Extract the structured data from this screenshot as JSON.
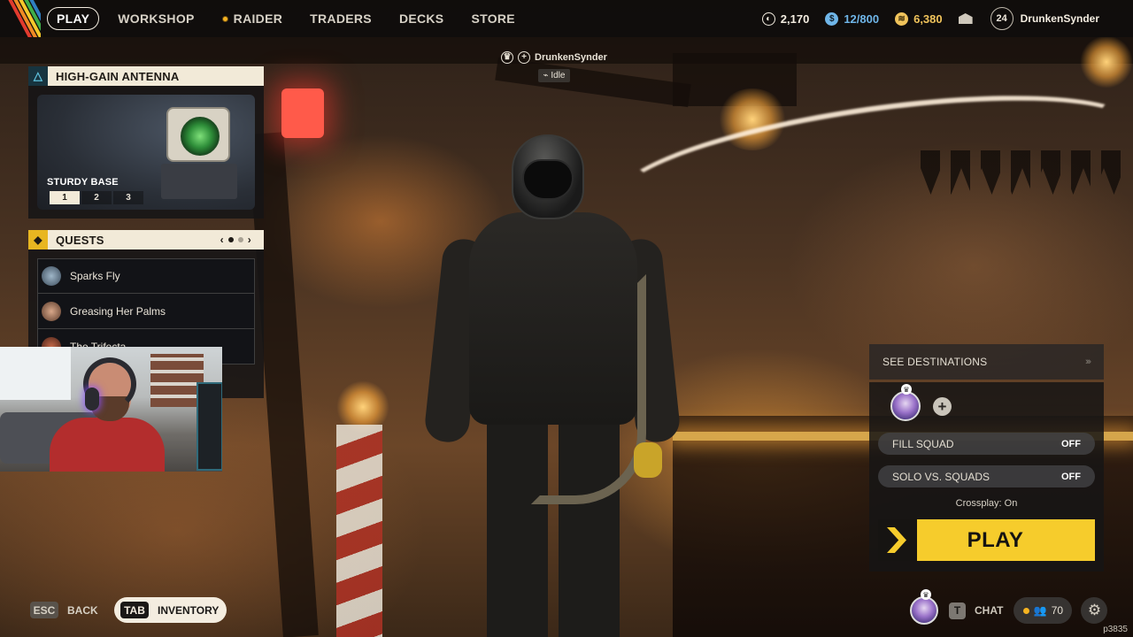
{
  "top_nav": {
    "items": [
      {
        "label": "PLAY",
        "active": true
      },
      {
        "label": "WORKSHOP"
      },
      {
        "label": "RAIDER",
        "icon": "raider-dot-icon"
      },
      {
        "label": "TRADERS"
      },
      {
        "label": "DECKS"
      },
      {
        "label": "STORE"
      }
    ]
  },
  "currencies": {
    "coins": "2,170",
    "capacity": "12/800",
    "credits": "6,380"
  },
  "profile": {
    "level": "24",
    "username": "DrunkenSynder"
  },
  "player_tag": {
    "name": "DrunkenSynder",
    "status": "Idle"
  },
  "antenna_panel": {
    "title": "HIGH-GAIN ANTENNA",
    "variant_name": "STURDY BASE",
    "variants": [
      "1",
      "2",
      "3"
    ],
    "selected_variant": "1"
  },
  "quests_panel": {
    "title": "QUESTS",
    "items": [
      {
        "name": "Sparks Fly"
      },
      {
        "name": "Greasing Her Palms"
      },
      {
        "name": "The Trifecta"
      }
    ]
  },
  "play_panel": {
    "destinations_label": "SEE DESTINATIONS",
    "fill_squad": {
      "label": "FILL SQUAD",
      "value": "OFF"
    },
    "solo_vs_squads": {
      "label": "SOLO VS. SQUADS",
      "value": "OFF"
    },
    "crossplay": "Crossplay: On",
    "play_label": "PLAY"
  },
  "bottom_bar": {
    "back_key": "ESC",
    "back_label": "BACK",
    "inventory_key": "TAB",
    "inventory_label": "INVENTORY",
    "chat_key": "T",
    "chat_label": "CHAT",
    "friends_count": "70"
  },
  "build_id": "p3835",
  "colors": {
    "accent_yellow": "#f6cc2c",
    "panel_header": "#f2ead8",
    "capacity_blue": "#6fb5e8",
    "credits_gold": "#f0c35b"
  }
}
